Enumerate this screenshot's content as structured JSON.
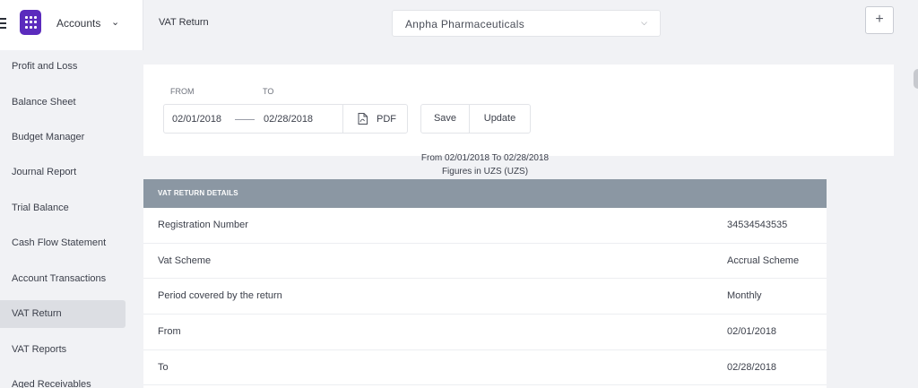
{
  "brand": {
    "label": "Accounts"
  },
  "header": {
    "title": "VAT Return",
    "company": "Anpha Pharmaceuticals",
    "add_label": "+"
  },
  "sidebar": {
    "items": [
      {
        "label": "Profit and Loss"
      },
      {
        "label": "Balance Sheet"
      },
      {
        "label": "Budget Manager"
      },
      {
        "label": "Journal Report"
      },
      {
        "label": "Trial Balance"
      },
      {
        "label": "Cash Flow Statement"
      },
      {
        "label": "Account Transactions"
      },
      {
        "label": "VAT Return",
        "active": true
      },
      {
        "label": "VAT Reports"
      },
      {
        "label": "Aged Receivables"
      }
    ]
  },
  "filters": {
    "from_label": "FROM",
    "to_label": "TO",
    "from_date": "02/01/2018",
    "to_date": "02/28/2018",
    "pdf_label": "PDF",
    "save_label": "Save",
    "update_label": "Update"
  },
  "report": {
    "period_text": "From 02/01/2018 To 02/28/2018",
    "currency_text": "Figures in UZS (UZS)",
    "section_title": "VAT RETURN DETAILS",
    "rows": [
      {
        "label": "Registration Number",
        "value": "34534543535"
      },
      {
        "label": "Vat Scheme",
        "value": "Accrual Scheme"
      },
      {
        "label": "Period covered by the return",
        "value": "Monthly"
      },
      {
        "label": "From",
        "value": "02/01/2018"
      },
      {
        "label": "To",
        "value": "02/28/2018"
      }
    ]
  },
  "icons": {
    "menu": "hamburger-icon",
    "logo": "app-grid-logo",
    "chevron": "chevron-down-icon",
    "pdf": "file-pdf-icon",
    "add": "plus-icon"
  },
  "colors": {
    "brand": "#5b2bbd",
    "section_header": "#8b97a3",
    "active_item": "#dcdee3"
  }
}
